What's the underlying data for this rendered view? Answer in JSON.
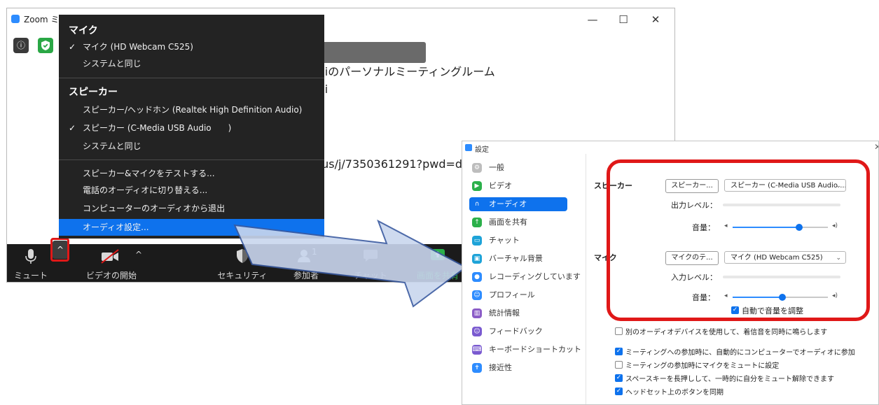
{
  "zoom_window": {
    "title": "Zoom ミ",
    "controls": {
      "minimize": "—",
      "maximize": "☐",
      "close": "✕"
    },
    "meeting": {
      "room_name": "aiのパーソナルミーティングルーム",
      "host": "ai",
      "invite_link": ".us/j/7350361291?pwd=d"
    },
    "toolbar": {
      "mute": "ミュート",
      "video_start": "ビデオの開始",
      "security": "セキュリティ",
      "participants": "参加者",
      "participants_count": "1",
      "chat": "チャット",
      "share": "画面を共有"
    }
  },
  "audio_menu": {
    "mic_header": "マイク",
    "mic_items": [
      {
        "label": "マイク (HD Webcam C525)",
        "checked": true
      },
      {
        "label": "システムと同じ",
        "checked": false
      }
    ],
    "speaker_header": "スピーカー",
    "speaker_items": [
      {
        "label": "スピーカー/ヘッドホン (Realtek High Definition Audio)",
        "checked": false
      },
      {
        "label": "スピーカー (C-Media USB Audio　　)",
        "checked": true
      },
      {
        "label": "システムと同じ",
        "checked": false
      }
    ],
    "actions": [
      "スピーカー&マイクをテストする...",
      "電話のオーディオに切り替える...",
      "コンピューターのオーディオから退出",
      "オーディオ設定..."
    ]
  },
  "settings": {
    "title": "設定",
    "close": "✕",
    "sidebar": [
      {
        "label": "一般",
        "icon": "gear-icon",
        "color": "#bdbdbd"
      },
      {
        "label": "ビデオ",
        "icon": "video-icon",
        "color": "#2bb04a"
      },
      {
        "label": "オーディオ",
        "icon": "headphones-icon",
        "color": "#0e72ed",
        "active": true
      },
      {
        "label": "画面を共有",
        "icon": "share-screen-icon",
        "color": "#2bb04a"
      },
      {
        "label": "チャット",
        "icon": "chat-icon",
        "color": "#1ea3d8"
      },
      {
        "label": "バーチャル背景",
        "icon": "virtual-background-icon",
        "color": "#1ea3d8"
      },
      {
        "label": "レコーディングしています",
        "icon": "recording-icon",
        "color": "#2d8cff"
      },
      {
        "label": "プロフィール",
        "icon": "profile-icon",
        "color": "#2d8cff"
      },
      {
        "label": "統計情報",
        "icon": "statistics-icon",
        "color": "#8b5cc7"
      },
      {
        "label": "フィードバック",
        "icon": "feedback-icon",
        "color": "#7a5ad0"
      },
      {
        "label": "キーボードショートカット",
        "icon": "keyboard-icon",
        "color": "#7a5ad0"
      },
      {
        "label": "接近性",
        "icon": "accessibility-icon",
        "color": "#2d8cff"
      }
    ],
    "audio": {
      "speaker_label": "スピーカー",
      "speaker_test_button": "スピーカー...",
      "speaker_device": "スピーカー (C-Media USB Audio ...",
      "output_level_label": "出力レベル：",
      "speaker_volume_label": "音量：",
      "speaker_volume": 0.7,
      "mic_label": "マイク",
      "mic_test_button": "マイクのテ...",
      "mic_device": "マイク (HD Webcam C525)",
      "input_level_label": "入力レベル：",
      "mic_volume_label": "音量：",
      "mic_volume": 0.52,
      "auto_adjust": "自動で音量を調整"
    },
    "options": [
      {
        "label": "別のオーディオデバイスを使用して、着信音を同時に鳴らします",
        "checked": false
      },
      {
        "label": "ミーティングへの参加時に、自動的にコンピューターでオーディオに参加",
        "checked": true
      },
      {
        "label": "ミーティングの参加時にマイクをミュートに設定",
        "checked": false
      },
      {
        "label": "スペースキーを長押しして、一時的に自分をミュート解除できます",
        "checked": true
      },
      {
        "label": "ヘッドセット上のボタンを同期",
        "checked": true
      }
    ]
  },
  "colors": {
    "accent": "#0e72ed",
    "highlight_red": "#e01818",
    "menu_bg": "#232323",
    "share_green": "#2bb04a",
    "arrow_fill": "#c9d6ee",
    "arrow_stroke": "#3a5aa0"
  }
}
